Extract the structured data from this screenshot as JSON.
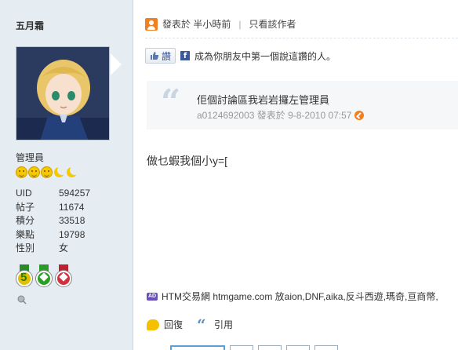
{
  "user": {
    "name": "五月霜",
    "rank": "管理員",
    "stats": [
      {
        "key": "UID",
        "value": "594257"
      },
      {
        "key": "帖子",
        "value": "11674"
      },
      {
        "key": "積分",
        "value": "33518"
      },
      {
        "key": "樂點",
        "value": "19798"
      },
      {
        "key": "性別",
        "value": "女"
      }
    ],
    "medal_1_number": "5"
  },
  "post": {
    "posted_label": "發表於 半小時前",
    "only_author": "只看該作者",
    "like_button": "讚",
    "like_text": "成為你朋友中第一個說這讚的人。",
    "fb_letter": "f",
    "quote": {
      "mark": "“",
      "title": "佢個討論區我岩岩攞左管理員",
      "meta": "a0124692003 發表於 9-8-2010 07:57"
    },
    "body": "做乜蝦我個小y=[",
    "ad_badge": "AD",
    "ad_text": "HTM交易網 htmgame.com 放aion,DNF,aika,反斗西遊,瑪奇,亘商幣,",
    "reply_label": "回復",
    "quote_label": "引用",
    "quote_icon": "“"
  },
  "colors": {
    "sidebar_bg": "#e5edf2",
    "accent_orange": "#f08020",
    "fb_blue": "#3b5998"
  }
}
